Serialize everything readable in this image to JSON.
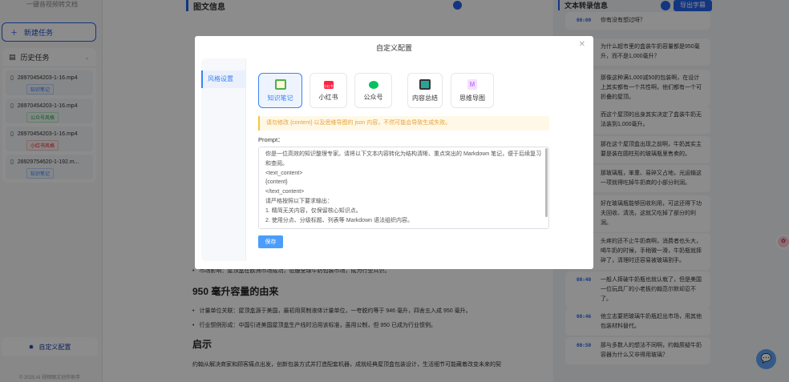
{
  "sidebar": {
    "subtitle": "一键音视频转文档",
    "new_task": "新建任务",
    "history_title": "历史任务",
    "tasks": [
      {
        "name": "28970454203-1-16.mp4",
        "tag": "知识笔记"
      },
      {
        "name": "28970454203-1-16.mp4",
        "tag": "公众号风格"
      },
      {
        "name": "28970454203-1-16.mp4",
        "tag": "小红书风格"
      },
      {
        "name": "28929754620-1-192.m...",
        "tag": "知识笔记"
      }
    ],
    "config_button": "自定义配置",
    "footer": "© 2025 AI 视频图文创作助手"
  },
  "main": {
    "title": "图文信息",
    "bullet_market": "市场影响：屋顶盒在欧洲市场成功，征服全球牛奶包装市场，成为行业共识。",
    "h_950": "950 毫升容量的由来",
    "bullets": [
      "计量单位关联：屋顶盒源于美国，最初用英制液体计量单位，一夸脱约等于 946 毫升，四舍五入成 950 毫升。",
      "行业惯例形成：中国引进美国屋顶盒生产线时沿用该标准，虽用公制，但 950 已成为行业惯例。"
    ],
    "h_insight": "启示",
    "insight": "约翰从解决商家和顾客痛点出发，创新包装方式并打造配套机器，成就经典屋顶盒包装设计，生活细节可能藏着改变未来的契"
  },
  "transcript": {
    "title": "文本转录信息",
    "export": "导出字幕",
    "items": [
      {
        "ts": "00:00",
        "text": "你有没有想过呀？"
      },
      {
        "ts": "",
        "text": "为什么超市里的盒装牛奶容量都是950毫升，而不是1,000毫升？"
      },
      {
        "ts": "",
        "text": "那像这种满1,000减50的包装啊，在设计上其实都有一个共性啊，他们都有一个可折叠的屋顶。"
      },
      {
        "ts": "",
        "text": "而这个屋顶的出身其实决定了盒装牛奶无法装到1,000毫升。"
      },
      {
        "ts": "",
        "text": "那在这个屋顶盒出现之前啊，牛奶其实主要是装在圆柱形的玻璃瓶里售卖的。"
      },
      {
        "ts": "",
        "text": "那玻璃瓶，笨重、易碎又占地，光运输这一项就得吃掉牛奶商的小部分利润。"
      },
      {
        "ts": "",
        "text": "好在玻璃瓶能够回收利用，可这还得下功夫回收、清洗，这就又吃掉了部分的利润。"
      },
      {
        "ts": "",
        "text": "头疼的还不止牛奶商啊，消费者也头大，喝牛奶的时候，手稍微一滑，牛奶瓶就摔碎了，清理时还容易被玻璃割手。"
      },
      {
        "ts": "00:40",
        "text": "一般人摔破牛奶瓶也就认栽了，但是美国一位玩具厂的小老板约翰范尔默却忍不了。"
      },
      {
        "ts": "00:46",
        "text": "他立志要把玻璃牛奶瓶赶出市场，用其他包装材料替代。"
      },
      {
        "ts": "00:50",
        "text": "那与多数人的想法不同啊，约翰质疑牛奶容器为什么又非得用玻璃？"
      }
    ]
  },
  "modal": {
    "title": "自定义配置",
    "nav": "风格设置",
    "styles": [
      {
        "label": "知识笔记",
        "icon": "notebook-icon",
        "color": "#4caf50"
      },
      {
        "label": "小红书",
        "icon": "xiaohongshu-icon",
        "color": "#ff2442",
        "logo": "小红书"
      },
      {
        "label": "公众号",
        "icon": "wechat-icon",
        "color": "#07c160"
      },
      {
        "label": "内容总结",
        "icon": "summary-chart-icon",
        "color": "#26a69a"
      },
      {
        "label": "思维导图",
        "icon": "mindmap-icon",
        "color": "#c77dff",
        "logo": "M"
      }
    ],
    "warning": "请勿修改 {content} 以及思维导图的 json 内容，不然可能会导致生成失败。",
    "prompt_label": "Prompt：",
    "prompt": "你是一位高效的知识整理专家。请将以下文本内容转化为结构清晰、重点突出的 Markdown 笔记，便于后续复习和查阅。\n<text_content>\n{content}\n</text_content>\n请严格按照以下要求输出：\n1. 精简无关内容，仅保留核心知识点。\n2. 使用分点、分级标题、列表等 Markdown 语法组织内容。",
    "save": "保存"
  }
}
